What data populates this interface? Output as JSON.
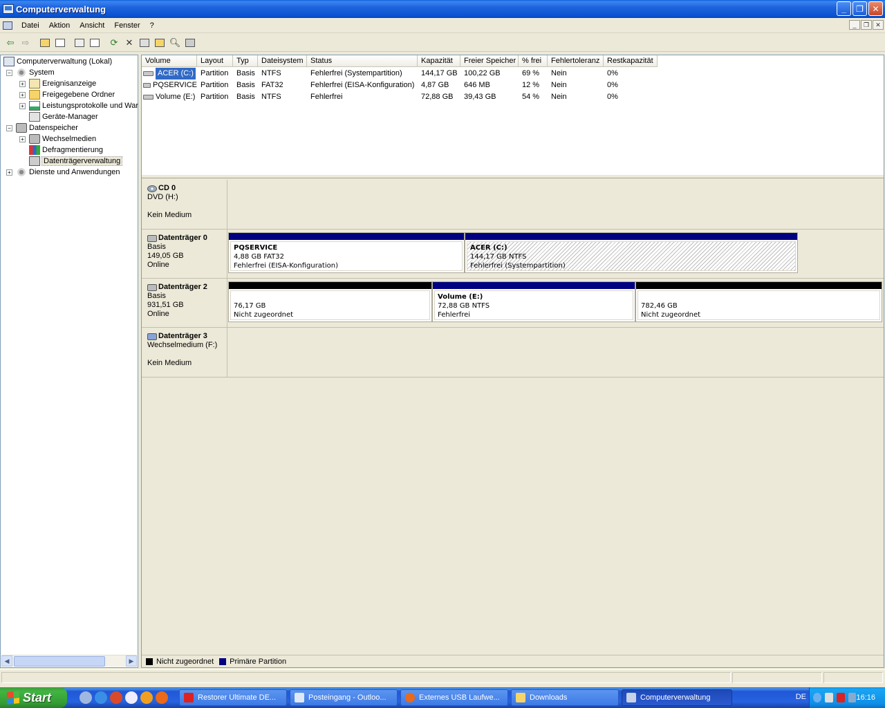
{
  "window": {
    "title": "Computerverwaltung",
    "controls": {
      "minimize": "_",
      "maximize": "❐",
      "close": "✕"
    }
  },
  "menu": {
    "items": [
      "Datei",
      "Aktion",
      "Ansicht",
      "Fenster",
      "?"
    ]
  },
  "toolbar": {
    "icons": [
      "back-icon",
      "forward-icon",
      "up-folder-icon",
      "show-tree-icon",
      "properties-icon",
      "help-icon",
      "refresh-icon",
      "delete-icon",
      "properties2-icon",
      "open-icon",
      "search-icon",
      "settings-icon"
    ]
  },
  "tree": {
    "root": "Computerverwaltung (Lokal)",
    "system": "System",
    "eventlog": "Ereignisanzeige",
    "shared": "Freigegebene Ordner",
    "perf": "Leistungsprotokolle und War",
    "devmgr": "Geräte-Manager",
    "storage": "Datenspeicher",
    "removable": "Wechselmedien",
    "defrag": "Defragmentierung",
    "diskmgmt": "Datenträgerverwaltung",
    "services": "Dienste und Anwendungen"
  },
  "volume_list": {
    "columns": [
      "Volume",
      "Layout",
      "Typ",
      "Dateisystem",
      "Status",
      "Kapazität",
      "Freier Speicher",
      "% frei",
      "Fehlertoleranz",
      "Restkapazität"
    ],
    "rows": [
      [
        "ACER (C:)",
        "Partition",
        "Basis",
        "NTFS",
        "Fehlerfrei (Systempartition)",
        "144,17 GB",
        "100,22 GB",
        "69 %",
        "Nein",
        "0%"
      ],
      [
        "PQSERVICE",
        "Partition",
        "Basis",
        "FAT32",
        "Fehlerfrei (EISA-Konfiguration)",
        "4,87 GB",
        "646 MB",
        "12 %",
        "Nein",
        "0%"
      ],
      [
        "Volume (E:)",
        "Partition",
        "Basis",
        "NTFS",
        "Fehlerfrei",
        "72,88 GB",
        "39,43 GB",
        "54 %",
        "Nein",
        "0%"
      ]
    ]
  },
  "disks": {
    "cd0": {
      "name": "CD 0",
      "line1": "DVD (H:)",
      "line2": "",
      "line3": "Kein Medium"
    },
    "disk0": {
      "name": "Datenträger 0",
      "line1": "Basis",
      "line2": "149,05 GB",
      "line3": "Online",
      "p1": {
        "title": "PQSERVICE",
        "size": "4,88 GB FAT32",
        "status": "Fehlerfrei (EISA-Konfiguration)"
      },
      "p2": {
        "title": "ACER  (C:)",
        "size": "144,17 GB NTFS",
        "status": "Fehlerfrei (Systempartition)"
      }
    },
    "disk2": {
      "name": "Datenträger 2",
      "line1": "Basis",
      "line2": "931,51 GB",
      "line3": "Online",
      "p1": {
        "title": "",
        "size": "76,17 GB",
        "status": "Nicht zugeordnet"
      },
      "p2": {
        "title": "Volume  (E:)",
        "size": "72,88 GB NTFS",
        "status": "Fehlerfrei"
      },
      "p3": {
        "title": "",
        "size": "782,46 GB",
        "status": "Nicht zugeordnet"
      }
    },
    "disk3": {
      "name": "Datenträger 3",
      "line1": "Wechselmedium (F:)",
      "line2": "",
      "line3": "Kein Medium"
    }
  },
  "legend": {
    "unallocated": "Nicht zugeordnet",
    "primary": "Primäre Partition",
    "unallocated_color": "#000000",
    "primary_color": "#000080"
  },
  "taskbar": {
    "start": "Start",
    "tasks": [
      "Restorer Ultimate DE...",
      "Posteingang - Outloo...",
      "Externes USB Laufwe...",
      "Downloads",
      "Computerverwaltung"
    ],
    "language": "DE",
    "clock": "16:16"
  }
}
